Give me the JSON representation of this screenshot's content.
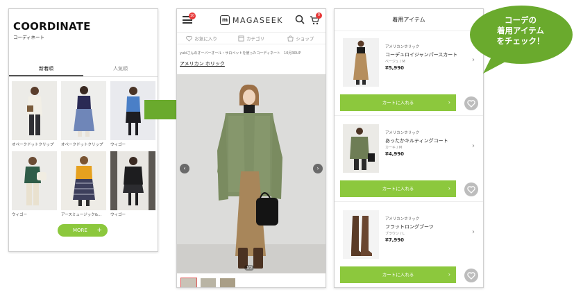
{
  "coordinate_panel": {
    "title": "COORDINATE",
    "subtitle": "コーディネート",
    "tabs": [
      {
        "label": "新着順",
        "active": true
      },
      {
        "label": "人気順",
        "active": false
      }
    ],
    "items": [
      {
        "caption": "オペークドットクリップ"
      },
      {
        "caption": "オペークドットクリップ"
      },
      {
        "caption": "ウィゴー"
      },
      {
        "caption": "ウィゴー"
      },
      {
        "caption": "アースミュージック&..."
      },
      {
        "caption": "ウィゴー"
      }
    ],
    "more_label": "MORE",
    "more_icon": "+"
  },
  "detail_panel": {
    "notification_count": "10",
    "logo_mark": "m",
    "logo_text": "MAGASEEK",
    "cart_count": "0",
    "nav": [
      {
        "label": "お気に入り",
        "icon": "heart-icon"
      },
      {
        "label": "カテゴリ",
        "icon": "category-icon"
      },
      {
        "label": "ショップ",
        "icon": "shop-icon"
      }
    ],
    "breadcrumb": "yukiさんのオーバーオール・サロペットを使ったコーディネート　10月30UP",
    "brand_link": "アメリカン ホリック",
    "prev_icon": "‹",
    "next_icon": "›",
    "pager": "1/3"
  },
  "items_panel": {
    "title": "着用アイテム",
    "cart_label": "カートに入れる",
    "items": [
      {
        "brand": "アメリカンホリック",
        "name": "コーデュロイジャンパースカート",
        "color": "ベージュ / M",
        "price": "¥5,990"
      },
      {
        "brand": "アメリカンホリック",
        "name": "あったかキルティングコート",
        "color": "カーキ / M",
        "price": "¥4,990"
      },
      {
        "brand": "アメリカンホリック",
        "name": "フラットロングブーツ",
        "color": "ブラウン / L",
        "price": "¥7,990"
      }
    ]
  },
  "callout": {
    "lines": [
      "コーデの",
      "着用アイテム",
      "をチェック！"
    ],
    "color": "#6aaa2d"
  },
  "colors": {
    "accent_green": "#8cc83d",
    "badge_red": "#e73939"
  }
}
